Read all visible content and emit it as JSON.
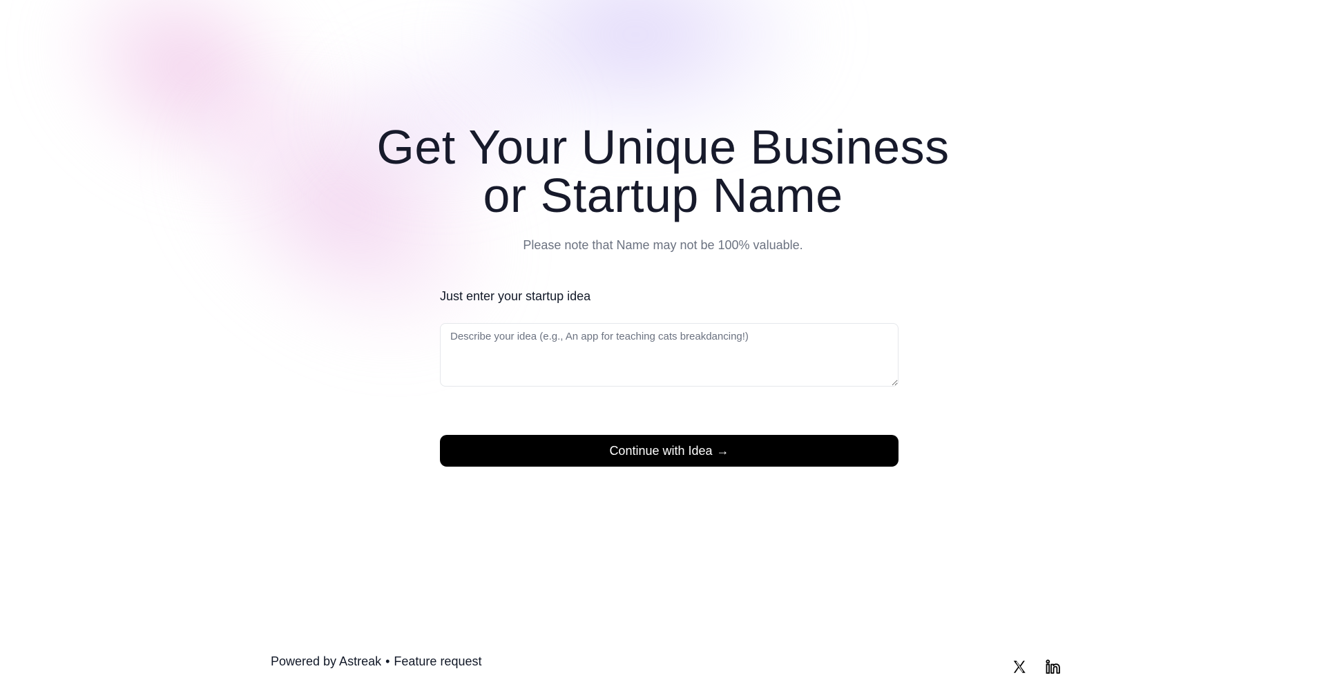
{
  "hero": {
    "title_line1": "Get Your Unique Business",
    "title_line2": "or Startup Name",
    "subtitle": "Please note that Name may not be 100% valuable."
  },
  "form": {
    "label": "Just enter your startup idea",
    "idea_value": "",
    "idea_placeholder": "Describe your idea (e.g., An app for teaching cats breakdancing!)",
    "continue_label": "Continue with Idea",
    "continue_arrow": "→"
  },
  "footer": {
    "powered_by": "Powered by Astreak",
    "separator": "•",
    "feature_request": "Feature request"
  },
  "social": {
    "x_icon": "x-twitter-icon",
    "linkedin_icon": "linkedin-icon"
  },
  "colors": {
    "button_bg": "#000000",
    "title": "#171a2b",
    "muted": "#6b7280",
    "blob_pink": "#e8aadc",
    "blob_violet": "#c8b9f5"
  }
}
